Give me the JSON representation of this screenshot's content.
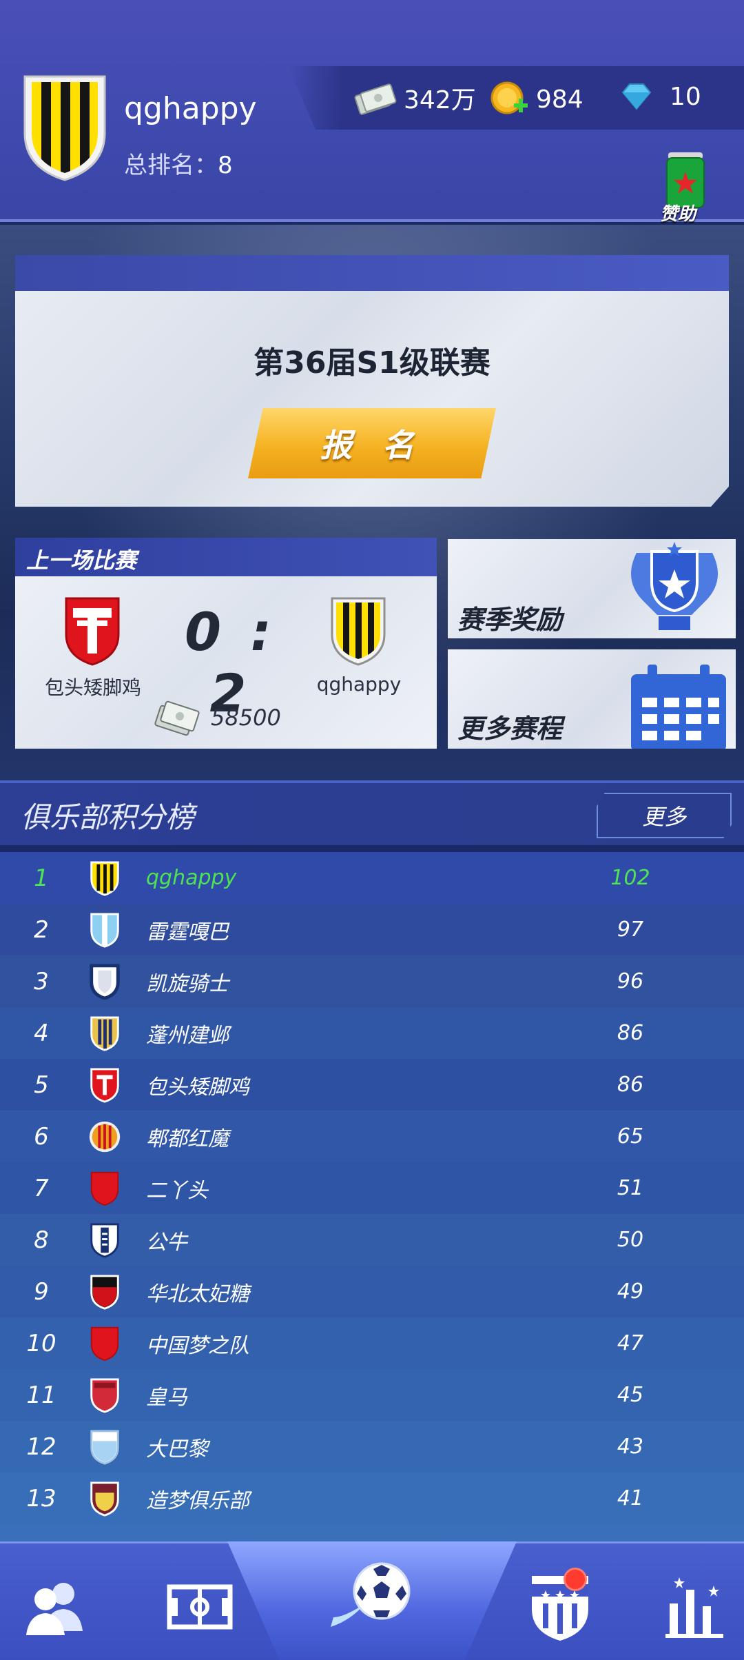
{
  "header": {
    "username": "qghappy",
    "rank_label": "总排名：",
    "rank_value": "8",
    "currency": {
      "cash": "342万",
      "coins": "984",
      "diamonds": "10"
    },
    "sponsor_label": "赞助"
  },
  "league": {
    "title": "第36届S1级联赛",
    "signup_label": "报 名"
  },
  "last_match": {
    "header": "上一场比赛",
    "home_team": "包头矮脚鸡",
    "away_team": "qghappy",
    "score": "0 : 2",
    "prize": "58500"
  },
  "side_cards": {
    "season_rewards": "赛季奖励",
    "more_schedule": "更多赛程"
  },
  "standings": {
    "title": "俱乐部积分榜",
    "more_label": "更多",
    "rows": [
      {
        "rank": "1",
        "name": "qghappy",
        "points": "102",
        "me": true,
        "crest": "yellow-black-stripes"
      },
      {
        "rank": "2",
        "name": "雷霆嘎巴",
        "points": "97",
        "crest": "light-blue-stripes"
      },
      {
        "rank": "3",
        "name": "凯旋骑士",
        "points": "96",
        "crest": "white-navy"
      },
      {
        "rank": "4",
        "name": "蓬州建邺",
        "points": "86",
        "crest": "gold-navy-stripes"
      },
      {
        "rank": "5",
        "name": "包头矮脚鸡",
        "points": "86",
        "crest": "red-white-cross"
      },
      {
        "rank": "6",
        "name": "郫都红魔",
        "points": "65",
        "crest": "orange-red-stripes-round"
      },
      {
        "rank": "7",
        "name": "二丫头",
        "points": "51",
        "crest": "red"
      },
      {
        "rank": "8",
        "name": "公牛",
        "points": "50",
        "crest": "navy-white"
      },
      {
        "rank": "9",
        "name": "华北太妃糖",
        "points": "49",
        "crest": "black-red"
      },
      {
        "rank": "10",
        "name": "中国梦之队",
        "points": "47",
        "crest": "red"
      },
      {
        "rank": "11",
        "name": "皇马",
        "points": "45",
        "crest": "crimson"
      },
      {
        "rank": "12",
        "name": "大巴黎",
        "points": "43",
        "crest": "light-blue-white"
      },
      {
        "rank": "13",
        "name": "造梦俱乐部",
        "points": "41",
        "crest": "maroon-gold"
      }
    ]
  },
  "nav": {
    "items": [
      "team-icon",
      "pitch-icon",
      "ball-icon",
      "club-shield-icon",
      "stats-icon"
    ]
  }
}
